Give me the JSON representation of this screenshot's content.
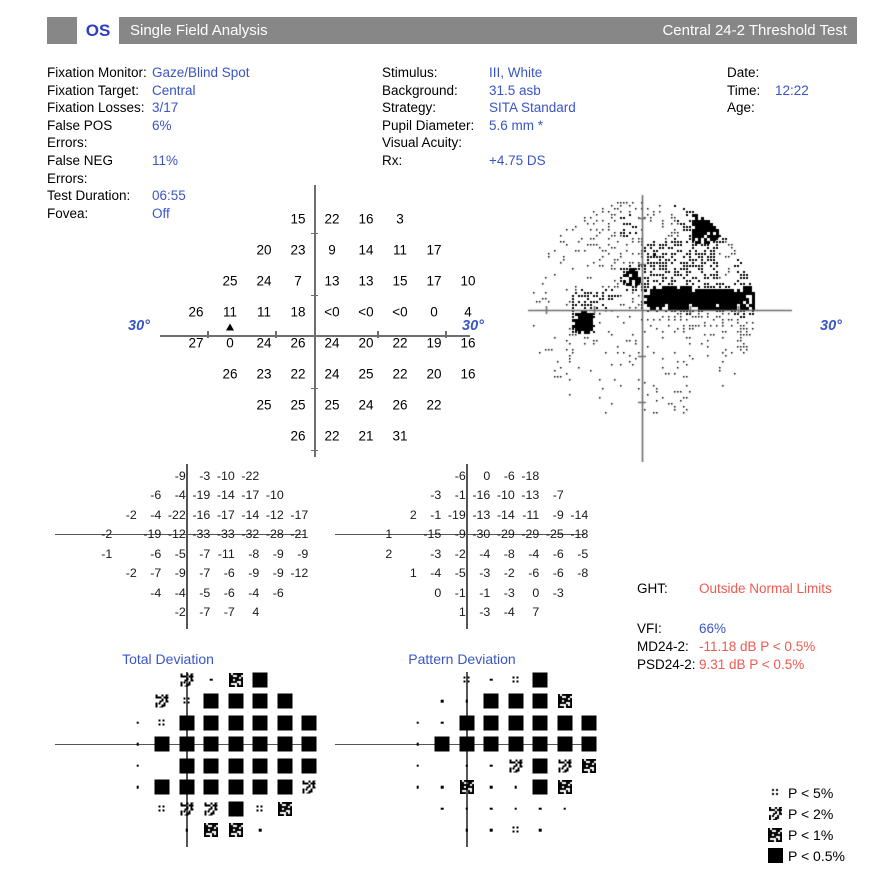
{
  "header": {
    "eye": "OS",
    "title": "Single Field Analysis",
    "test_name": "Central 24-2 Threshold Test"
  },
  "params_left": [
    {
      "label": "Fixation Monitor:",
      "value": "Gaze/Blind Spot"
    },
    {
      "label": "Fixation Target:",
      "value": "Central"
    },
    {
      "label": "Fixation Losses:",
      "value": "3/17"
    },
    {
      "label": "False POS Errors:",
      "value": "6%"
    },
    {
      "label": "False NEG Errors:",
      "value": "11%"
    },
    {
      "label": "Test Duration:",
      "value": "06:55"
    },
    {
      "label": "Fovea:",
      "value": "Off"
    }
  ],
  "params_mid": [
    {
      "label": "Stimulus:",
      "value": "III, White"
    },
    {
      "label": "Background:",
      "value": "31.5 asb"
    },
    {
      "label": "Strategy:",
      "value": "SITA Standard"
    },
    {
      "label": "Pupil Diameter:",
      "value": "5.6 mm *"
    },
    {
      "label": "Visual Acuity:",
      "value": ""
    }
  ],
  "params_rx": {
    "label": "Rx:",
    "value": "+4.75 DS"
  },
  "params_right": [
    {
      "label": "Date:",
      "value": ""
    },
    {
      "label": "Time:",
      "value": "12:22"
    },
    {
      "label": "Age:",
      "value": ""
    }
  ],
  "axis_labels": {
    "left_deg": "30°",
    "mid_deg": "30°",
    "right_deg": "30°"
  },
  "captions": {
    "total_deviation": "Total Deviation",
    "pattern_deviation": "Pattern Deviation"
  },
  "indices": {
    "ght_label": "GHT:",
    "ght_value": "Outside Normal Limits",
    "vfi_label": "VFI:",
    "vfi_value": "66%",
    "md_label": "MD24-2:",
    "md_value": "-11.18 dB P < 0.5%",
    "psd_label": "PSD24-2:",
    "psd_value": "9.31 dB P < 0.5%"
  },
  "legend": [
    {
      "symbol": "p5-icon",
      "text": "P < 5%"
    },
    {
      "symbol": "p2-icon",
      "text": "P < 2%"
    },
    {
      "symbol": "p1-icon",
      "text": "P < 1%"
    },
    {
      "symbol": "p05-icon",
      "text": "P < 0.5%"
    }
  ],
  "colors": {
    "accent_blue": "#3a55c8",
    "alert_red": "#f0594f",
    "header_gray": "#878787"
  },
  "chart_data": {
    "type": "table",
    "title": "Central 24-2 Threshold Test (OS)",
    "grid_note": "24-2 test pattern: 54 points arranged in rows of 4,6,8,9,9,8,6,4 with blind spot marker",
    "threshold_rows": [
      {
        "cols": [
          3,
          4,
          5,
          6
        ],
        "values": [
          "15",
          "22",
          "16",
          "3"
        ]
      },
      {
        "cols": [
          2,
          3,
          4,
          5,
          6,
          7
        ],
        "values": [
          "20",
          "23",
          "9",
          "14",
          "11",
          "17"
        ]
      },
      {
        "cols": [
          1,
          2,
          3,
          4,
          5,
          6,
          7,
          8
        ],
        "values": [
          "25",
          "24",
          "7",
          "13",
          "13",
          "15",
          "17",
          "10"
        ]
      },
      {
        "cols": [
          0,
          1,
          2,
          3,
          4,
          5,
          6,
          7,
          8
        ],
        "values": [
          "26",
          "11",
          "11",
          "18",
          "<0",
          "<0",
          "<0",
          "0",
          "4"
        ]
      },
      {
        "cols": [
          0,
          1,
          2,
          3,
          4,
          5,
          6,
          7,
          8
        ],
        "values": [
          "27",
          "0",
          "24",
          "26",
          "24",
          "20",
          "22",
          "19",
          "16"
        ]
      },
      {
        "cols": [
          1,
          2,
          3,
          4,
          5,
          6,
          7,
          8
        ],
        "values": [
          "26",
          "23",
          "22",
          "24",
          "25",
          "22",
          "20",
          "16"
        ]
      },
      {
        "cols": [
          2,
          3,
          4,
          5,
          6,
          7
        ],
        "values": [
          "25",
          "25",
          "25",
          "24",
          "26",
          "22"
        ]
      },
      {
        "cols": [
          3,
          4,
          5,
          6
        ],
        "values": [
          "26",
          "22",
          "21",
          "31"
        ]
      }
    ],
    "blind_spot": {
      "row": 3,
      "col": 1
    },
    "total_deviation_rows": [
      {
        "cols": [
          3,
          4,
          5,
          6
        ],
        "values": [
          "-9",
          "-3",
          "-10",
          "-22"
        ]
      },
      {
        "cols": [
          2,
          3,
          4,
          5,
          6,
          7
        ],
        "values": [
          "-6",
          "-4",
          "-19",
          "-14",
          "-17",
          "-10"
        ]
      },
      {
        "cols": [
          1,
          2,
          3,
          4,
          5,
          6,
          7,
          8
        ],
        "values": [
          "-2",
          "-4",
          "-22",
          "-16",
          "-17",
          "-14",
          "-12",
          "-17"
        ]
      },
      {
        "cols": [
          0,
          2,
          3,
          4,
          5,
          6,
          7,
          8
        ],
        "values": [
          "-2",
          "-19",
          "-12",
          "-33",
          "-33",
          "-32",
          "-28",
          "-21"
        ]
      },
      {
        "cols": [
          0,
          2,
          3,
          4,
          5,
          6,
          7,
          8
        ],
        "values": [
          "-1",
          "-6",
          "-5",
          "-7",
          "-11",
          "-8",
          "-9",
          "-9"
        ]
      },
      {
        "cols": [
          1,
          2,
          3,
          4,
          5,
          6,
          7,
          8
        ],
        "values": [
          "-2",
          "-7",
          "-9",
          "-7",
          "-6",
          "-9",
          "-9",
          "-12"
        ]
      },
      {
        "cols": [
          2,
          3,
          4,
          5,
          6,
          7
        ],
        "values": [
          "-4",
          "-4",
          "-5",
          "-6",
          "-4",
          "-6"
        ]
      },
      {
        "cols": [
          3,
          4,
          5,
          6
        ],
        "values": [
          "-2",
          "-7",
          "-7",
          "4"
        ]
      }
    ],
    "pattern_deviation_rows": [
      {
        "cols": [
          3,
          4,
          5,
          6
        ],
        "values": [
          "-6",
          "0",
          "-6",
          "-18"
        ]
      },
      {
        "cols": [
          2,
          3,
          4,
          5,
          6,
          7
        ],
        "values": [
          "-3",
          "-1",
          "-16",
          "-10",
          "-13",
          "-7"
        ]
      },
      {
        "cols": [
          1,
          2,
          3,
          4,
          5,
          6,
          7,
          8
        ],
        "values": [
          "2",
          "-1",
          "-19",
          "-13",
          "-14",
          "-11",
          "-9",
          "-14"
        ]
      },
      {
        "cols": [
          0,
          2,
          3,
          4,
          5,
          6,
          7,
          8
        ],
        "values": [
          "1",
          "-15",
          "-9",
          "-30",
          "-29",
          "-29",
          "-25",
          "-18"
        ]
      },
      {
        "cols": [
          0,
          2,
          3,
          4,
          5,
          6,
          7,
          8
        ],
        "values": [
          "2",
          "-3",
          "-2",
          "-4",
          "-8",
          "-4",
          "-6",
          "-5"
        ]
      },
      {
        "cols": [
          1,
          2,
          3,
          4,
          5,
          6,
          7,
          8
        ],
        "values": [
          "1",
          "-4",
          "-5",
          "-3",
          "-2",
          "-6",
          "-6",
          "-8"
        ]
      },
      {
        "cols": [
          2,
          3,
          4,
          5,
          6,
          7
        ],
        "values": [
          "0",
          "-1",
          "-1",
          "-3",
          "0",
          "-3"
        ]
      },
      {
        "cols": [
          3,
          4,
          5,
          6
        ],
        "values": [
          "1",
          "-3",
          "-4",
          "7"
        ]
      }
    ],
    "total_deviation_symbols": [
      {
        "cols": [
          3,
          4,
          5,
          6
        ],
        "values": [
          "p2",
          "dot",
          "p1",
          "p05"
        ]
      },
      {
        "cols": [
          2,
          3,
          4,
          5,
          6,
          7
        ],
        "values": [
          "p2",
          "p5",
          "p05",
          "p05",
          "p05",
          "p05"
        ]
      },
      {
        "cols": [
          1,
          2,
          3,
          4,
          5,
          6,
          7,
          8
        ],
        "values": [
          "dot",
          "p5",
          "p05",
          "p05",
          "p05",
          "p05",
          "p05",
          "p05"
        ]
      },
      {
        "cols": [
          1,
          2,
          3,
          4,
          5,
          6,
          7,
          8
        ],
        "values": [
          "dot",
          "p05",
          "p05",
          "p05",
          "p05",
          "p05",
          "p05",
          "p05"
        ]
      },
      {
        "cols": [
          1,
          3,
          4,
          5,
          6,
          7,
          8
        ],
        "values": [
          "dot",
          "p05",
          "p05",
          "p05",
          "p05",
          "p05",
          "p05"
        ]
      },
      {
        "cols": [
          1,
          2,
          3,
          4,
          5,
          6,
          7,
          8
        ],
        "values": [
          "dot",
          "p05",
          "p05",
          "p05",
          "p05",
          "p05",
          "p05",
          "p2"
        ]
      },
      {
        "cols": [
          2,
          3,
          4,
          5,
          6,
          7
        ],
        "values": [
          "p5",
          "p2",
          "p2",
          "p05",
          "p5",
          "p1"
        ]
      },
      {
        "cols": [
          3,
          4,
          5,
          6
        ],
        "values": [
          "dot",
          "p1",
          "p1",
          "dot"
        ]
      }
    ],
    "pattern_deviation_symbols": [
      {
        "cols": [
          3,
          4,
          5,
          6
        ],
        "values": [
          "p5",
          "dot",
          "p5",
          "p05"
        ]
      },
      {
        "cols": [
          2,
          3,
          4,
          5,
          6,
          7
        ],
        "values": [
          "dot",
          "dot",
          "p05",
          "p05",
          "p05",
          "p1"
        ]
      },
      {
        "cols": [
          1,
          2,
          3,
          4,
          5,
          6,
          7,
          8
        ],
        "values": [
          "dot",
          "dot",
          "p05",
          "p05",
          "p05",
          "p05",
          "p05",
          "p05"
        ]
      },
      {
        "cols": [
          1,
          2,
          3,
          4,
          5,
          6,
          7,
          8
        ],
        "values": [
          "dot",
          "p05",
          "p05",
          "p05",
          "p05",
          "p05",
          "p05",
          "p05"
        ]
      },
      {
        "cols": [
          1,
          3,
          4,
          5,
          6,
          7,
          8
        ],
        "values": [
          "dot",
          "dot",
          "dot",
          "p2",
          "p05",
          "p2",
          "p1"
        ]
      },
      {
        "cols": [
          1,
          2,
          3,
          4,
          5,
          6,
          7
        ],
        "values": [
          "dot",
          "dot",
          "p1",
          "dot",
          "dot",
          "p05",
          "p1"
        ]
      },
      {
        "cols": [
          2,
          3,
          4,
          5,
          6,
          7
        ],
        "values": [
          "dot",
          "dot",
          "dot",
          "dot",
          "dot",
          "dot"
        ]
      },
      {
        "cols": [
          3,
          4,
          5,
          6
        ],
        "values": [
          "dot",
          "dot",
          "p5",
          "dot"
        ]
      }
    ]
  }
}
